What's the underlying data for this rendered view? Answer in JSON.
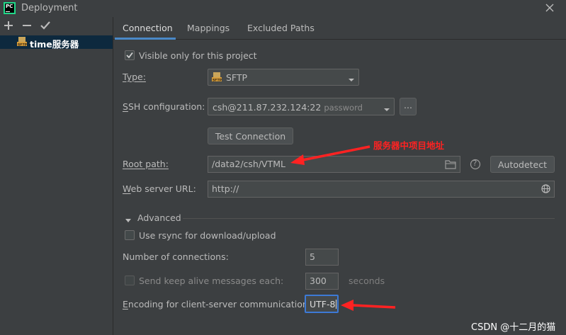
{
  "window": {
    "title": "Deployment"
  },
  "app_icon": {
    "text": "PC"
  },
  "sidebar": {
    "items": [
      {
        "label": "time服务器",
        "icon": "sftp-icon"
      }
    ]
  },
  "tabs": [
    {
      "label": "Connection",
      "active": true
    },
    {
      "label": "Mappings",
      "active": false
    },
    {
      "label": "Excluded Paths",
      "active": false
    }
  ],
  "connection": {
    "visible_only_label": "Visible only for this project",
    "visible_only_checked": true,
    "type_label": "Type:",
    "type_value": "SFTP",
    "ssh_label": "SSH configuration:",
    "ssh_value": "csh@211.87.232.124:22",
    "ssh_auth": "password",
    "ssh_more_label": "...",
    "test_button": "Test Connection",
    "root_label": "Root path:",
    "root_value": "/data2/csh/VTML",
    "help_label": "?",
    "autodetect_button": "Autodetect",
    "web_label": "Web server URL:",
    "web_value": "http://"
  },
  "advanced": {
    "title": "Advanced",
    "rsync_label": "Use rsync for download/upload",
    "rsync_checked": false,
    "connections_label": "Number of connections:",
    "connections_value": "5",
    "keepalive_label": "Send keep alive messages each:",
    "keepalive_checked": false,
    "keepalive_value": "300",
    "keepalive_unit": "seconds",
    "encoding_label": "Encoding for client-server communication:",
    "encoding_value": "UTF-8"
  },
  "annotation": {
    "text": "服务器中项目地址",
    "color": "#ff2222"
  },
  "watermark": {
    "text": "CSDN @十二月的猫"
  },
  "colors": {
    "accent": "#4a88c7",
    "selection": "#0d293e",
    "background": "#3c3f41",
    "annotation": "#ff2222"
  }
}
